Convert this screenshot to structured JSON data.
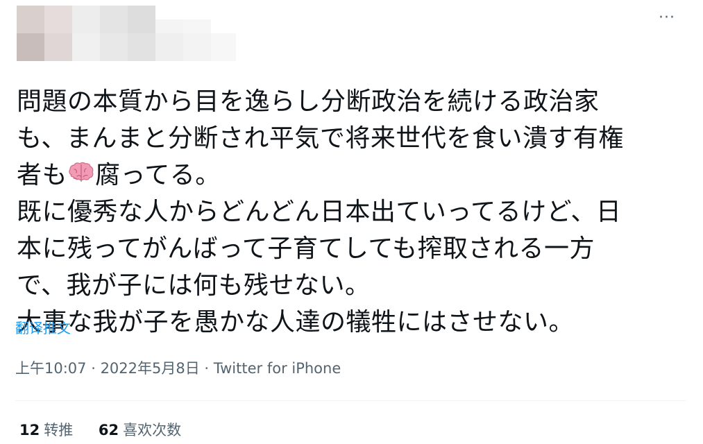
{
  "header": {
    "more_label": "···"
  },
  "tweet": {
    "lines": [
      "問題の本質から目を逸らし分断政治を続ける政治家",
      "も、まんまと分断され平気で将来世代を食い潰す有権",
      "者も",
      "腐ってる。",
      "既に優秀な人からどんどん日本出ていってるけど、日",
      "本に残ってがんばって子育てしても搾取される一方",
      "で、我が子には何も残せない。",
      "大事な我が子を愚かな人達の犠牲にはさせない。"
    ],
    "emoji": "brain-icon"
  },
  "translate_label": "翻译推文",
  "meta": {
    "time": "上午10:07",
    "separator1": " · ",
    "date": "2022年5月8日",
    "separator2": " · ",
    "source": "Twitter for iPhone"
  },
  "stats": {
    "retweets_count": "12",
    "retweets_label": "转推",
    "likes_count": "62",
    "likes_label": "喜欢次数"
  },
  "colors": {
    "text": "#0f1419",
    "secondary": "#536471",
    "link": "#1d9bf0",
    "divider": "#eff3f4",
    "brain": "#f29bb4"
  }
}
